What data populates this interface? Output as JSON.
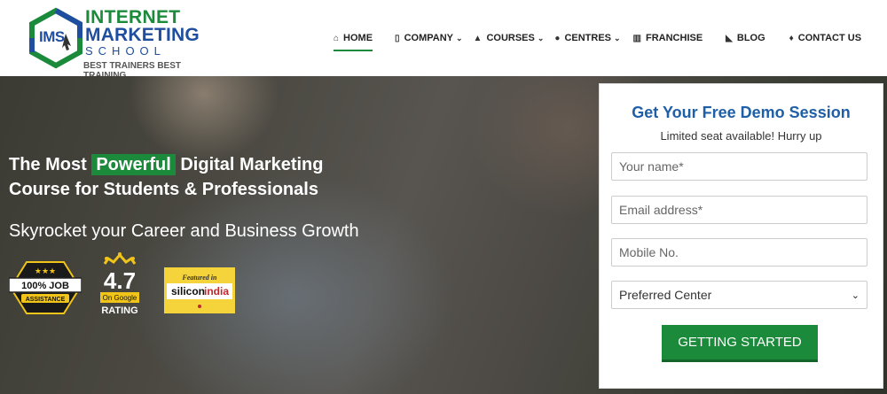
{
  "logo": {
    "abbr": "IMS",
    "line1": "INTERNET",
    "line2": "MARKETING",
    "line3": "SCHOOL",
    "tagline": "BEST TRAINERS BEST TRAINING"
  },
  "nav": {
    "items": [
      {
        "label": "HOME",
        "icon": "home-icon",
        "dropdown": false,
        "active": true
      },
      {
        "label": "COMPANY",
        "icon": "building-icon",
        "dropdown": true
      },
      {
        "label": "COURSES",
        "icon": "graduation-cap-icon",
        "dropdown": true
      },
      {
        "label": "CENTRES",
        "icon": "globe-icon",
        "dropdown": true
      },
      {
        "label": "FRANCHISE",
        "icon": "institution-icon",
        "dropdown": false
      },
      {
        "label": "BLOG",
        "icon": "rss-icon",
        "dropdown": false
      },
      {
        "label": "CONTACT US",
        "icon": "map-pin-icon",
        "dropdown": false
      }
    ]
  },
  "hero": {
    "title_pre": "The Most",
    "title_highlight": "Powerful",
    "title_post": "Digital Marketing",
    "title_line2": "Course for Students & Professionals",
    "subtitle": "Skyrocket your Career and Business Growth"
  },
  "badges": {
    "job": {
      "stars": "★★★",
      "line1": "100% JOB",
      "line2": "ASSISTANCE"
    },
    "rating": {
      "value": "4.7",
      "source": "On Google",
      "label": "RATING"
    },
    "featured": {
      "top": "Featured in",
      "brand_a": "silicon",
      "brand_b": "india"
    }
  },
  "form": {
    "title": "Get Your Free Demo Session",
    "subtitle": "Limited seat available! Hurry up",
    "name_placeholder": "Your name*",
    "email_placeholder": "Email address*",
    "mobile_placeholder": "Mobile No.",
    "center_selected": "Preferred Center",
    "submit_label": "GETTING STARTED"
  },
  "colors": {
    "brand_green": "#1c8a3b",
    "brand_blue": "#1f5fa8"
  }
}
